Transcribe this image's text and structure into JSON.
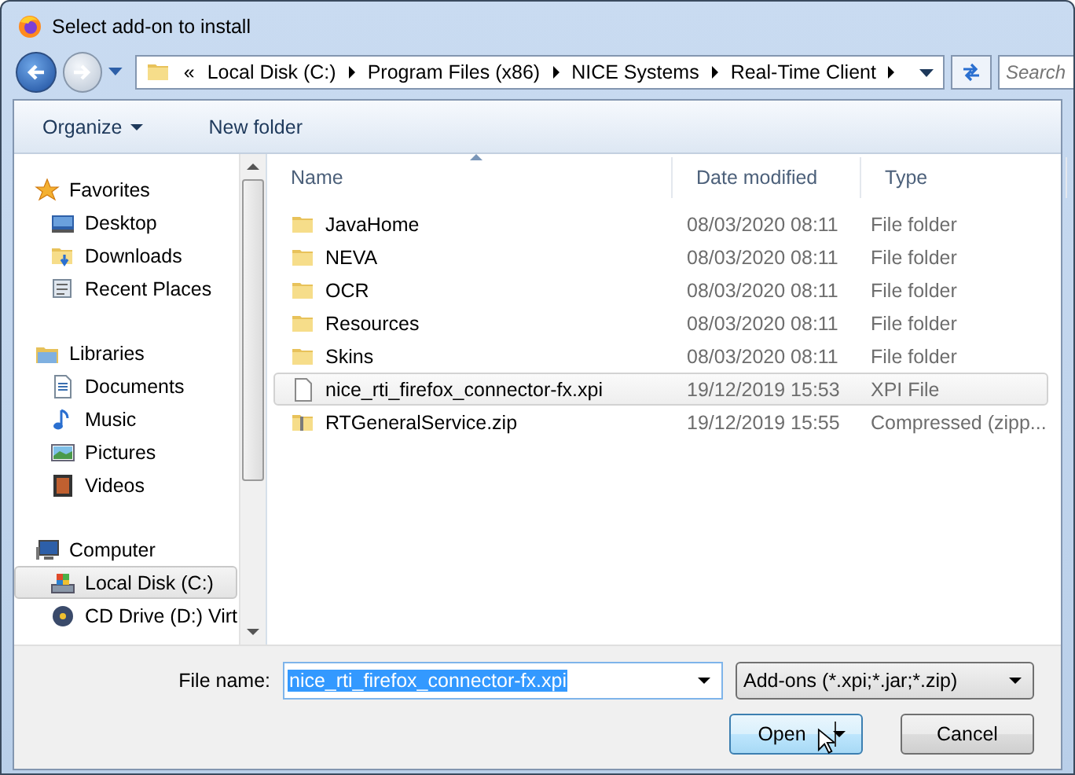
{
  "window": {
    "title": "Select add-on to install"
  },
  "address_bar": {
    "overflow": "«",
    "crumbs": [
      "Local Disk (C:)",
      "Program Files (x86)",
      "NICE Systems",
      "Real-Time Client"
    ]
  },
  "search": {
    "placeholder": "Search"
  },
  "toolbar": [
    {
      "label": "Organize",
      "kind": "menu"
    },
    {
      "label": "New folder",
      "kind": "plain"
    }
  ],
  "sidebar": {
    "items": [
      {
        "label": "Favorites",
        "kind": "star",
        "selected": false,
        "children": [
          {
            "label": "Desktop",
            "kind": "desktop",
            "selected": false
          },
          {
            "label": "Downloads",
            "kind": "downloads",
            "selected": false
          },
          {
            "label": "Recent Places",
            "kind": "recent",
            "selected": false
          }
        ]
      },
      {
        "label": "Libraries",
        "kind": "library",
        "selected": false,
        "children": [
          {
            "label": "Documents",
            "kind": "document",
            "selected": false
          },
          {
            "label": "Music",
            "kind": "music",
            "selected": false
          },
          {
            "label": "Pictures",
            "kind": "picture",
            "selected": false
          },
          {
            "label": "Videos",
            "kind": "video",
            "selected": false
          }
        ]
      },
      {
        "label": "Computer",
        "kind": "computer",
        "selected": false,
        "children": [
          {
            "label": "Local Disk (C:)",
            "kind": "disk",
            "selected": true
          },
          {
            "label": "CD Drive (D:) Virt",
            "kind": "cd",
            "selected": false
          }
        ]
      }
    ]
  },
  "table": {
    "columns": [
      {
        "label": "Name",
        "sorted": true
      },
      {
        "label": "Date modified",
        "sorted": false
      },
      {
        "label": "Type",
        "sorted": false
      }
    ],
    "rows": [
      {
        "name": "JavaHome",
        "date": "08/03/2020 08:11",
        "type": "File folder",
        "kind": "folder",
        "selected": false
      },
      {
        "name": "NEVA",
        "date": "08/03/2020 08:11",
        "type": "File folder",
        "kind": "folder",
        "selected": false
      },
      {
        "name": "OCR",
        "date": "08/03/2020 08:11",
        "type": "File folder",
        "kind": "folder",
        "selected": false
      },
      {
        "name": "Resources",
        "date": "08/03/2020 08:11",
        "type": "File folder",
        "kind": "folder",
        "selected": false
      },
      {
        "name": "Skins",
        "date": "08/03/2020 08:11",
        "type": "File folder",
        "kind": "folder",
        "selected": false
      },
      {
        "name": "nice_rti_firefox_connector-fx.xpi",
        "date": "19/12/2019 15:53",
        "type": "XPI File",
        "kind": "file",
        "selected": true
      },
      {
        "name": "RTGeneralService.zip",
        "date": "19/12/2019 15:55",
        "type": "Compressed (zipp...",
        "kind": "zip",
        "selected": false
      }
    ]
  },
  "file_name": {
    "label": "File name:",
    "value": "nice_rti_firefox_connector-fx.xpi"
  },
  "file_type": {
    "value": "Add-ons (*.xpi;*.jar;*.zip)"
  },
  "buttons": [
    {
      "label": "Open",
      "kind": "split",
      "default": true
    },
    {
      "label": "Cancel",
      "kind": "plain",
      "default": false
    }
  ]
}
